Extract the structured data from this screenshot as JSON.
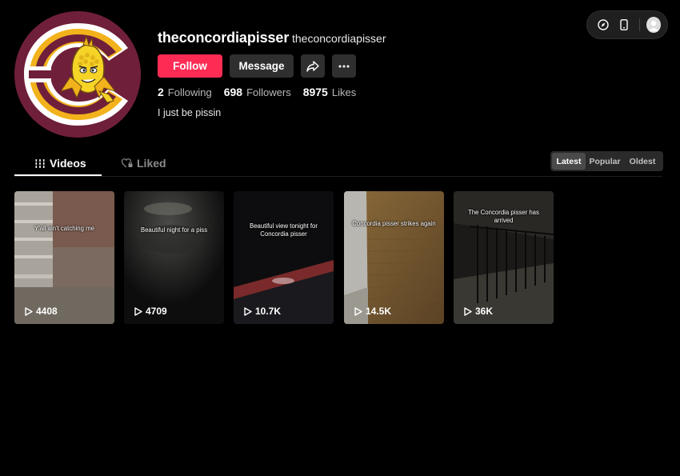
{
  "profile": {
    "username": "theconcordiapisser",
    "nickname": "theconcordiapisser",
    "bio": "I just be pissin",
    "follow_label": "Follow",
    "message_label": "Message"
  },
  "stats": {
    "following_count": "2",
    "following_label": "Following",
    "followers_count": "698",
    "followers_label": "Followers",
    "likes_count": "8975",
    "likes_label": "Likes"
  },
  "tabs": {
    "videos_label": "Videos",
    "liked_label": "Liked"
  },
  "sort": {
    "latest": "Latest",
    "popular": "Popular",
    "oldest": "Oldest",
    "active": "Latest"
  },
  "videos": [
    {
      "caption": "Y'all ain't catching me",
      "views": "4408"
    },
    {
      "caption": "Beautiful night for a piss",
      "views": "4709"
    },
    {
      "caption": "Beautiful view tonight for Concordia pisser",
      "views": "10.7K"
    },
    {
      "caption": "Concordia pisser strikes again",
      "views": "14.5K"
    },
    {
      "caption": "The Concordia pisser has arrived",
      "views": "36K"
    }
  ],
  "colors": {
    "follow_accent": "#fe2c55",
    "logo_maroon": "#6f1f3a",
    "logo_gold": "#f2b21b"
  },
  "icons": {
    "top_bar": [
      "compass-icon",
      "phone-icon",
      "user-avatar-icon"
    ],
    "tab_videos": "grid-bars-icon",
    "tab_liked": "heart-lock-icon",
    "view_count": "play-icon"
  }
}
